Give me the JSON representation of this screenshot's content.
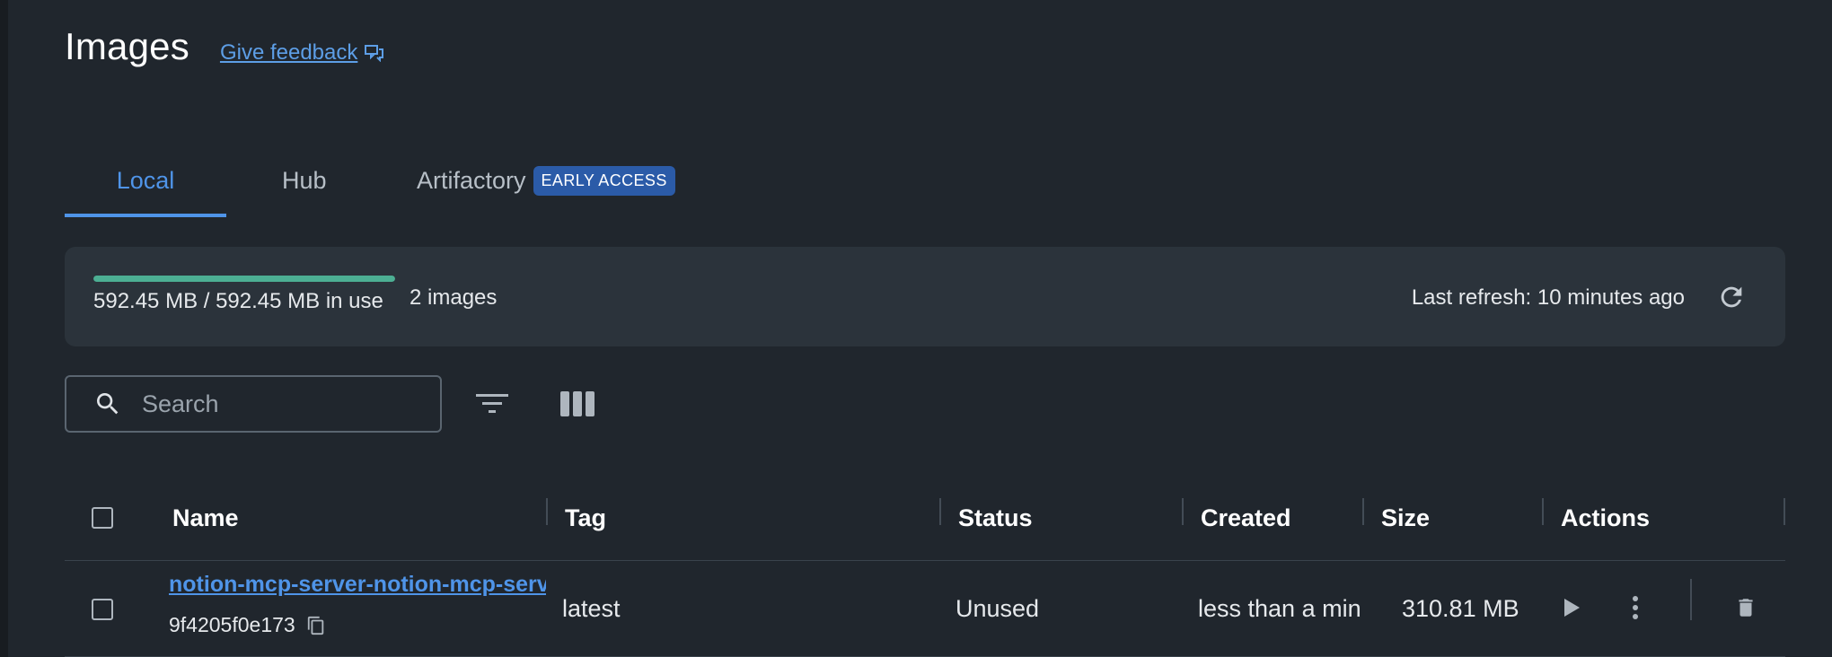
{
  "header": {
    "title": "Images",
    "feedback_label": "Give feedback"
  },
  "tabs": [
    {
      "label": "Local",
      "active": true
    },
    {
      "label": "Hub",
      "active": false
    },
    {
      "label": "Artifactory",
      "active": false,
      "badge": "EARLY ACCESS"
    }
  ],
  "summary": {
    "usage_text": "592.45 MB / 592.45 MB in use",
    "usage_fraction": 1.0,
    "image_count": "2 images",
    "last_refresh": "Last refresh: 10 minutes ago"
  },
  "search": {
    "placeholder": "Search",
    "value": ""
  },
  "table": {
    "columns": [
      "Name",
      "Tag",
      "Status",
      "Created",
      "Size",
      "Actions"
    ],
    "rows": [
      {
        "name": "notion-mcp-server-notion-mcp-server",
        "id": "9f4205f0e173",
        "tag": "latest",
        "status": "Unused",
        "created": "less than a minute ago",
        "size": "310.81 MB"
      }
    ]
  },
  "icons": {
    "feedback": "feedback-icon",
    "refresh": "refresh-icon",
    "search": "search-icon",
    "filter": "filter-icon",
    "columns": "columns-icon",
    "copy": "copy-icon",
    "run": "play-icon",
    "more": "more-vertical-icon",
    "delete": "trash-icon"
  },
  "colors": {
    "background": "#20262d",
    "accent": "#4f94e8",
    "progress": "#4caf93",
    "badge": "#2b5ba8"
  }
}
